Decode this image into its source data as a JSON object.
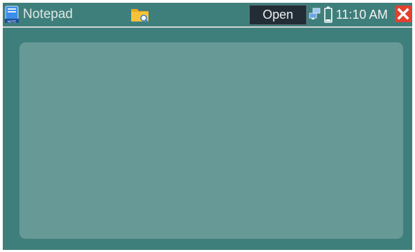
{
  "app": {
    "title": "Notepad",
    "icon": "notepad-icon",
    "icon_caption": "NOTE"
  },
  "toolbar": {
    "folder_icon": "folder-search-icon",
    "open_label": "Open"
  },
  "status": {
    "network_icon": "network-icon",
    "battery_icon": "battery-icon",
    "time": "11:10 AM",
    "close_icon": "close-icon"
  },
  "editor": {
    "value": "",
    "placeholder": ""
  },
  "colors": {
    "background": "#3f7f7b",
    "editor_background": "#679997",
    "open_button": "#222d36",
    "close_button": "#e2402f",
    "folder": "#f5b52a"
  }
}
